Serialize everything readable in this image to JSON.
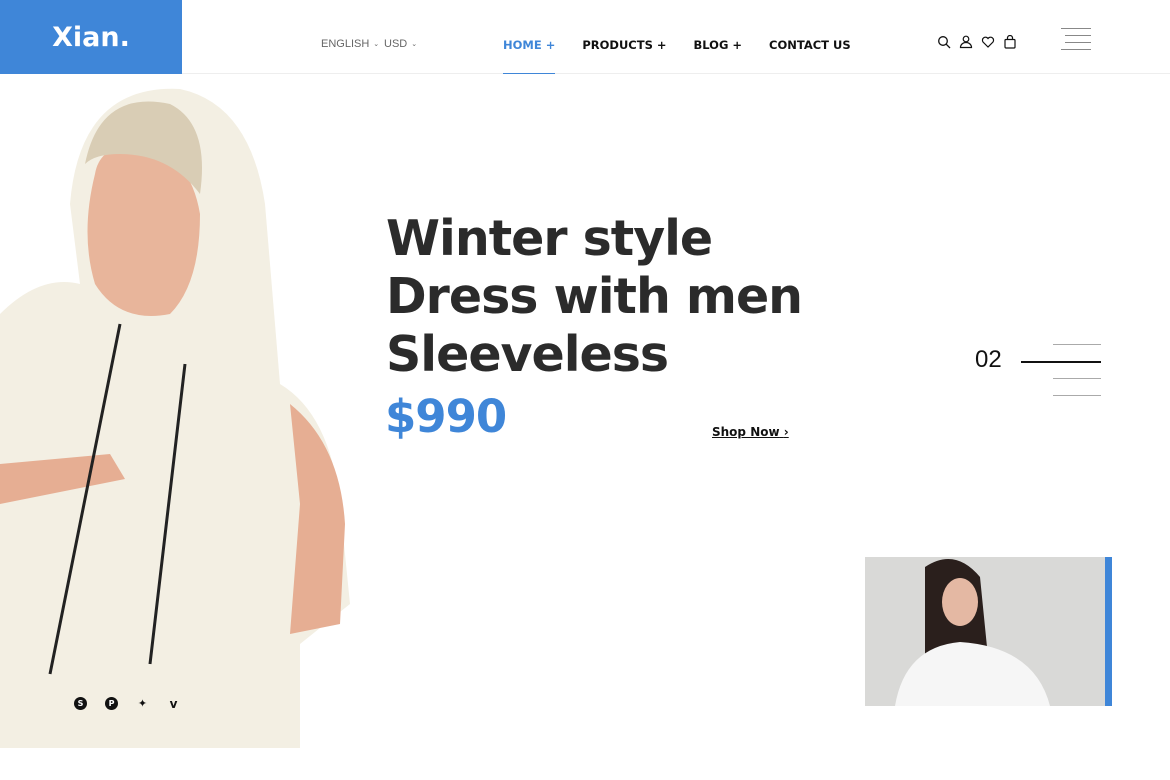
{
  "brand": {
    "logo": "Xian."
  },
  "header": {
    "language": "ENGLISH",
    "currency": "USD",
    "nav": [
      {
        "label": "HOME +",
        "active": true
      },
      {
        "label": "PRODUCTS +"
      },
      {
        "label": "BLOG +"
      },
      {
        "label": "CONTACT US"
      }
    ],
    "icons": [
      "search-icon",
      "user-icon",
      "heart-icon",
      "shopping-bag-icon",
      "hamburger-menu-icon"
    ]
  },
  "hero": {
    "title_lines": [
      "Winter style",
      "Dress with men",
      "Sleeveless"
    ],
    "price": "$990",
    "cta": "Shop Now",
    "slide_number": "02"
  },
  "social": [
    "skype-icon",
    "pinterest-icon",
    "twitter-icon",
    "vimeo-icon"
  ],
  "colors": {
    "accent": "#3f86d8",
    "text": "#2b2b2b"
  }
}
